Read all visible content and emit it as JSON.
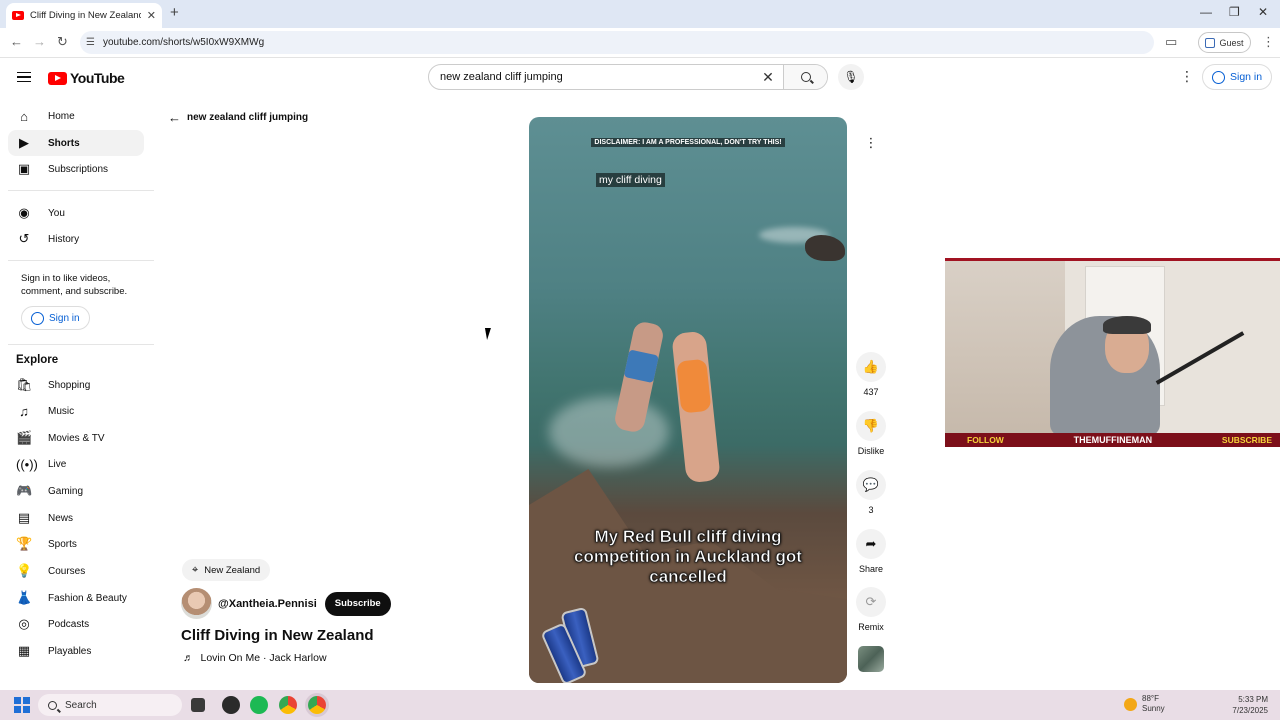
{
  "browser": {
    "tab_title": "Cliff Diving in New Zealand - YouTube",
    "url": "youtube.com/shorts/w5I0xW9XMWg",
    "profile_label": "Guest"
  },
  "header": {
    "logo_text": "YouTube",
    "search_value": "new zealand cliff jumping",
    "signin_label": "Sign in"
  },
  "sidebar": {
    "items": [
      {
        "label": "Home",
        "icon": "home-icon"
      },
      {
        "label": "Shorts",
        "icon": "shorts-icon"
      },
      {
        "label": "Subscriptions",
        "icon": "subscriptions-icon"
      },
      {
        "label": "You",
        "icon": "you-icon"
      },
      {
        "label": "History",
        "icon": "history-icon"
      }
    ],
    "signin_note": "Sign in to like videos, comment, and subscribe.",
    "signin_label": "Sign in",
    "explore_heading": "Explore",
    "explore_items": [
      {
        "label": "Shopping",
        "icon": "shopping-icon"
      },
      {
        "label": "Music",
        "icon": "music-icon"
      },
      {
        "label": "Movies & TV",
        "icon": "movies-icon"
      },
      {
        "label": "Live",
        "icon": "live-icon"
      },
      {
        "label": "Gaming",
        "icon": "gaming-icon"
      },
      {
        "label": "News",
        "icon": "news-icon"
      },
      {
        "label": "Sports",
        "icon": "sports-icon"
      },
      {
        "label": "Courses",
        "icon": "courses-icon"
      },
      {
        "label": "Fashion & Beauty",
        "icon": "fashion-icon"
      },
      {
        "label": "Podcasts",
        "icon": "podcasts-icon"
      },
      {
        "label": "Playables",
        "icon": "playables-icon"
      }
    ]
  },
  "main": {
    "back_label": "new zealand cliff jumping",
    "video": {
      "disclaimer": "DISCLAIMER: I AM A PROFESSIONAL, DON'T TRY THIS!",
      "sticker": "my cliff diving",
      "caption": "My Red Bull cliff diving competition in Auckland got cancelled"
    },
    "location": "New Zealand",
    "channel": "@Xantheia.Pennisi",
    "subscribe_label": "Subscribe",
    "title": "Cliff Diving in New Zealand",
    "music": "Lovin On Me · Jack Harlow",
    "actions": {
      "likes": "437",
      "dislike_label": "Dislike",
      "comments": "3",
      "share_label": "Share",
      "remix_label": "Remix"
    }
  },
  "overlay": {
    "follow": "FOLLOW",
    "name": "THEMUFFINEMAN",
    "subscribe": "SUBSCRIBE"
  },
  "taskbar": {
    "search_placeholder": "Search",
    "temperature": "88°F",
    "weather": "Sunny",
    "time": "5:33 PM",
    "date": "7/23/2025"
  },
  "colors": {
    "youtube_red": "#ff0000",
    "link_blue": "#065fd4",
    "overlay_red": "#7c0f1a",
    "overlay_yellow": "#f5d33a"
  }
}
